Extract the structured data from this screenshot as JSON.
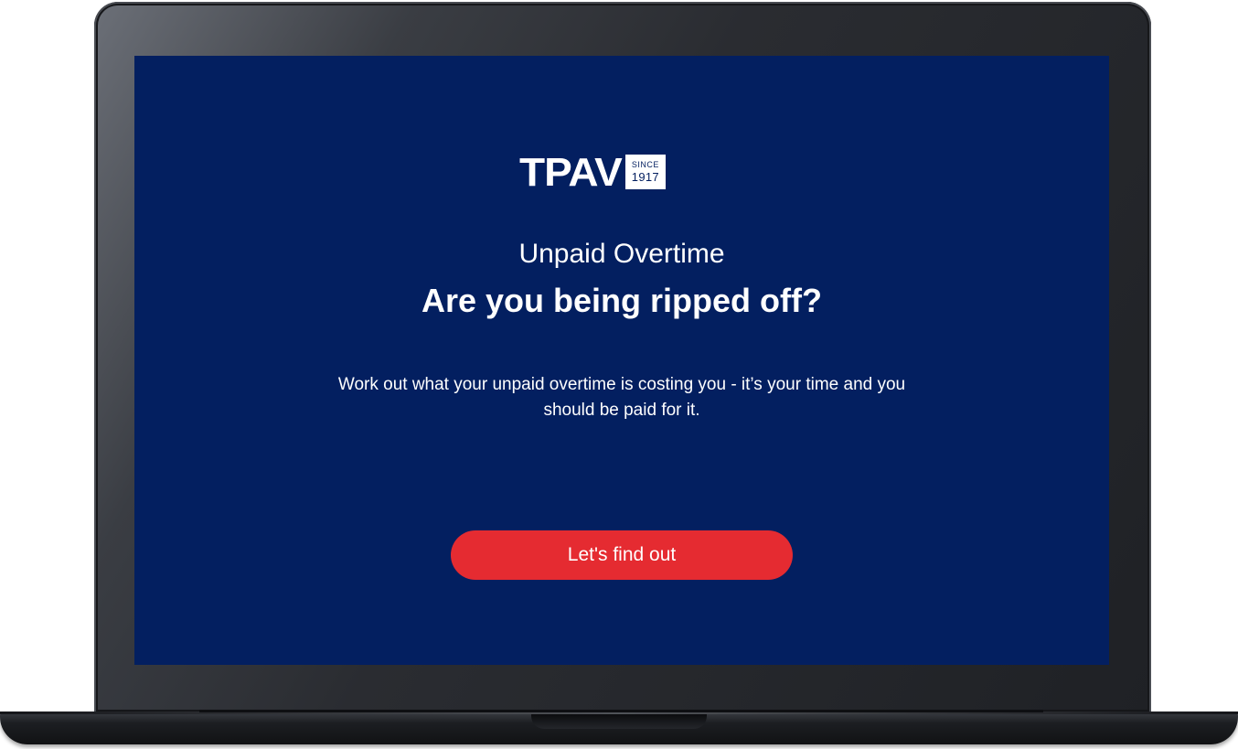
{
  "logo": {
    "wordmark": "TPAV",
    "since": "SINCE",
    "year": "1917"
  },
  "hero": {
    "subtitle": "Unpaid Overtime",
    "headline": "Are you being ripped off?",
    "description": "Work out what your unpaid overtime is costing you - it’s your time and you should be paid for it."
  },
  "cta": {
    "label": "Let's find out"
  },
  "colors": {
    "background": "#031f60",
    "button": "#e52b31",
    "text": "#ffffff"
  }
}
